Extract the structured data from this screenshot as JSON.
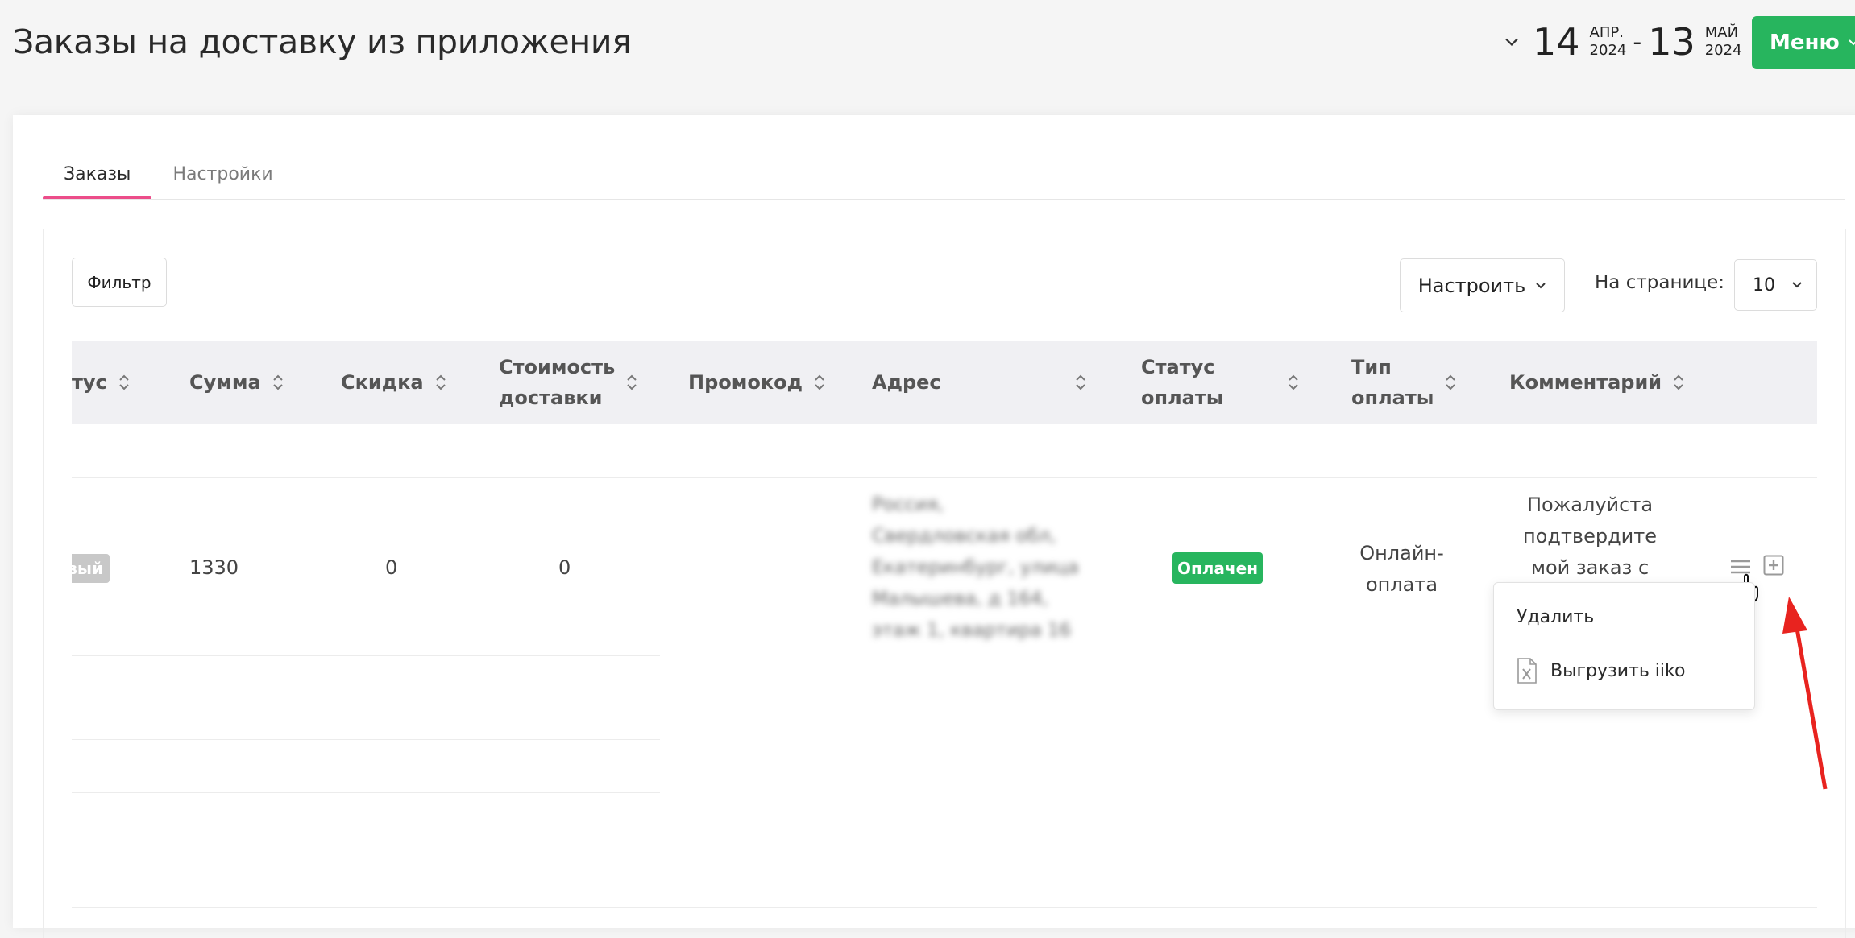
{
  "page": {
    "title": "Заказы на доставку из приложения"
  },
  "date_range": {
    "from_day": "14",
    "from_month": "АПР.",
    "from_year": "2024",
    "separator": "-",
    "to_day": "13",
    "to_month": "МАЙ",
    "to_year": "2024"
  },
  "menu": {
    "label": "Меню"
  },
  "tabs": [
    {
      "label": "Заказы",
      "active": true
    },
    {
      "label": "Настройки",
      "active": false
    }
  ],
  "toolbar": {
    "filter_label": "Фильтр",
    "configure_label": "Настроить",
    "per_page_label": "На странице:",
    "per_page_value": "10"
  },
  "table": {
    "columns": [
      {
        "key": "status",
        "label": "тус"
      },
      {
        "key": "sum",
        "label": "Сумма"
      },
      {
        "key": "discount",
        "label": "Скидка"
      },
      {
        "key": "delivery_cost",
        "label_line1": "Стоимость",
        "label_line2": "доставки"
      },
      {
        "key": "promo",
        "label": "Промокод"
      },
      {
        "key": "address",
        "label": "Адрес"
      },
      {
        "key": "payment_status",
        "label_line1": "Статус",
        "label_line2": "оплаты"
      },
      {
        "key": "payment_type",
        "label_line1": "Тип",
        "label_line2": "оплаты"
      },
      {
        "key": "comment",
        "label": "Комментарий"
      }
    ],
    "row": {
      "status_badge": "вый",
      "sum": "1330",
      "discount": "0",
      "delivery_cost": "0",
      "address_lines": [
        "Россия,",
        "Свердловская обл,",
        "Екатеринбург, улица",
        "Малышева, д 164,",
        "этаж 1, квартира 16"
      ],
      "payment_status": "Оплачен",
      "payment_type_lines": [
        "Онлайн-",
        "оплата"
      ],
      "comment_lines": [
        "Пожалуйста",
        "подтвердите",
        "мой заказ с"
      ]
    }
  },
  "row_menu": {
    "items": [
      {
        "label": "Удалить"
      },
      {
        "label": "Выгрузить iiko"
      }
    ]
  },
  "icons": {
    "menu": "hamburger-icon",
    "expand": "plus-square-icon",
    "cursor": "hand-pointer-icon",
    "excel": "excel-file-icon",
    "annotation": "red-arrow-annotation"
  },
  "colors": {
    "accent_green": "#27b55e",
    "tab_underline": "#ec4d8a",
    "annotation_red": "#e8231f"
  }
}
